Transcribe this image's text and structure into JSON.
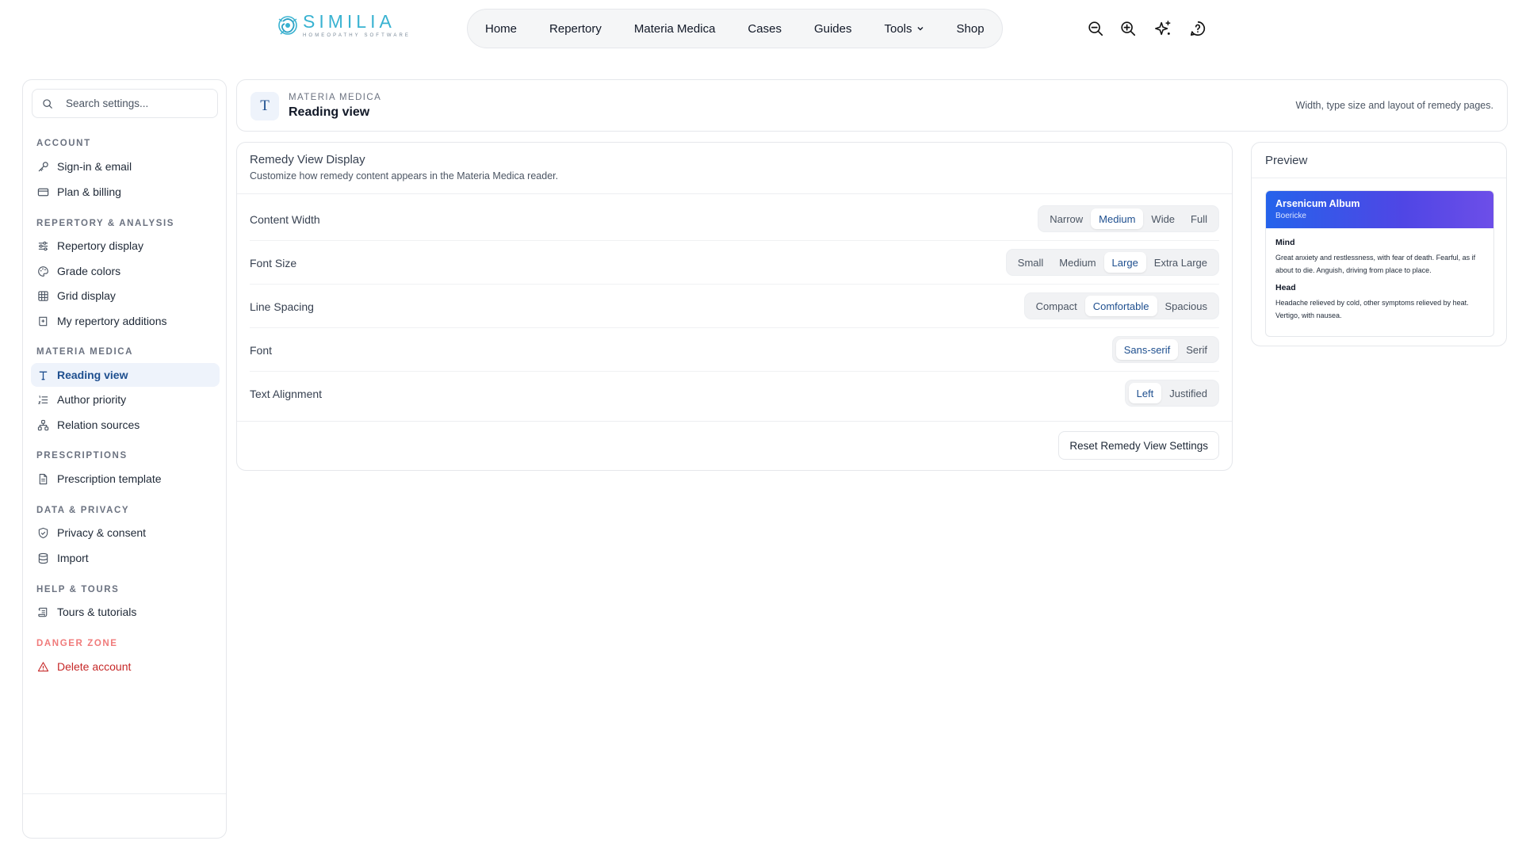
{
  "brand": {
    "name": "SIMILIA",
    "tagline": "HOMEOPATHY SOFTWARE"
  },
  "nav": {
    "items": [
      "Home",
      "Repertory",
      "Materia Medica",
      "Cases",
      "Guides",
      "Tools",
      "Shop"
    ],
    "tools_has_dropdown": true
  },
  "top_icons": [
    "zoom-out-icon",
    "zoom-in-icon",
    "sparkles-icon",
    "help-chat-icon"
  ],
  "sidebar": {
    "search_placeholder": "Search settings...",
    "sections": [
      {
        "title": "ACCOUNT",
        "items": [
          {
            "label": "Sign-in & email",
            "icon": "key-icon"
          },
          {
            "label": "Plan & billing",
            "icon": "credit-card-icon"
          }
        ]
      },
      {
        "title": "REPERTORY & ANALYSIS",
        "items": [
          {
            "label": "Repertory display",
            "icon": "sliders-icon"
          },
          {
            "label": "Grade colors",
            "icon": "palette-icon"
          },
          {
            "label": "Grid display",
            "icon": "grid-icon"
          },
          {
            "label": "My repertory additions",
            "icon": "book-plus-icon"
          }
        ]
      },
      {
        "title": "MATERIA MEDICA",
        "items": [
          {
            "label": "Reading view",
            "icon": "type-icon",
            "active": true
          },
          {
            "label": "Author priority",
            "icon": "list-ordered-icon"
          },
          {
            "label": "Relation sources",
            "icon": "network-icon"
          }
        ]
      },
      {
        "title": "PRESCRIPTIONS",
        "items": [
          {
            "label": "Prescription template",
            "icon": "file-text-icon"
          }
        ]
      },
      {
        "title": "DATA & PRIVACY",
        "items": [
          {
            "label": "Privacy & consent",
            "icon": "shield-check-icon"
          },
          {
            "label": "Import",
            "icon": "database-icon"
          }
        ]
      },
      {
        "title": "HELP & TOURS",
        "items": [
          {
            "label": "Tours & tutorials",
            "icon": "scroll-icon"
          }
        ]
      },
      {
        "title": "DANGER ZONE",
        "danger": true,
        "items": [
          {
            "label": "Delete account",
            "icon": "alert-triangle-icon"
          }
        ]
      }
    ]
  },
  "header": {
    "icon_glyph": "T",
    "category": "MATERIA MEDICA",
    "title": "Reading view",
    "description": "Width, type size and layout of remedy pages."
  },
  "settings": {
    "title": "Remedy View Display",
    "subtitle": "Customize how remedy content appears in the Materia Medica reader.",
    "rows": [
      {
        "label": "Content Width",
        "options": [
          "Narrow",
          "Medium",
          "Wide",
          "Full"
        ],
        "selected": "Medium"
      },
      {
        "label": "Font Size",
        "options": [
          "Small",
          "Medium",
          "Large",
          "Extra Large"
        ],
        "selected": "Large"
      },
      {
        "label": "Line Spacing",
        "options": [
          "Compact",
          "Comfortable",
          "Spacious"
        ],
        "selected": "Comfortable"
      },
      {
        "label": "Font",
        "options": [
          "Sans-serif",
          "Serif"
        ],
        "selected": "Sans-serif"
      },
      {
        "label": "Text Alignment",
        "options": [
          "Left",
          "Justified"
        ],
        "selected": "Left"
      }
    ],
    "reset_label": "Reset Remedy View Settings"
  },
  "preview": {
    "title": "Preview",
    "remedy_name": "Arsenicum Album",
    "author": "Boericke",
    "sections": [
      {
        "heading": "Mind",
        "text": "Great anxiety and restlessness, with fear of death. Fearful, as if about to die. Anguish, driving from place to place."
      },
      {
        "heading": "Head",
        "text": "Headache relieved by cold, other symptoms relieved by heat. Vertigo, with nausea."
      }
    ]
  }
}
